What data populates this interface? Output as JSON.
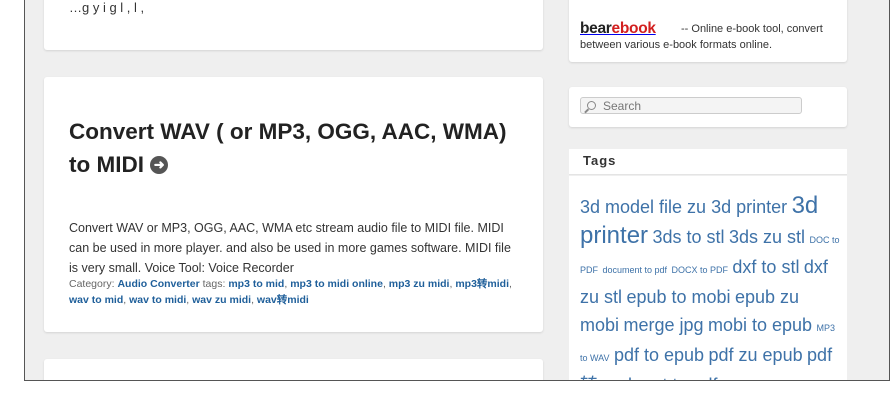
{
  "post_top": {
    "cut_text": "…g     y         i     g       l       ,    l  ,"
  },
  "post": {
    "title": "Convert WAV ( or MP3, OGG, AAC, WMA) to MIDI",
    "go_icon": "arrow-right-circle-icon",
    "text": "Convert WAV or MP3, OGG, AAC, WMA etc stream audio file to MIDI file. MIDI can be used in more player. and also be used in more games software. MIDI file is very small. Voice Tool: Voice Recorder",
    "category_label": "Category:",
    "category": "Audio Converter",
    "tags_label": "tags:",
    "tags": [
      "mp3 to mid",
      "mp3 to midi online",
      "mp3 zu midi",
      "mp3转midi",
      "wav to mid",
      "wav to midi",
      "wav zu midi",
      "wav转midi"
    ]
  },
  "sidebar": {
    "bearebook": {
      "logo_part1": "bear",
      "logo_part2": "ebook",
      "desc_line1": "-- Online e-book tool, convert",
      "desc_line2": "between various e-book formats online."
    },
    "search": {
      "placeholder": "Search",
      "icon": "search-icon"
    },
    "tags_title": "Tags",
    "tag_cloud": [
      {
        "label": "3d model file zu 3d printer",
        "size": 18
      },
      {
        "label": "3d printer",
        "size": 24
      },
      {
        "label": "3ds to stl",
        "size": 18
      },
      {
        "label": "3ds zu stl",
        "size": 18
      },
      {
        "label": "DOC to PDF",
        "size": 9
      },
      {
        "label": "document to pdf",
        "size": 9
      },
      {
        "label": "DOCX to PDF",
        "size": 9
      },
      {
        "label": "dxf to stl",
        "size": 18
      },
      {
        "label": "dxf zu stl",
        "size": 18
      },
      {
        "label": "epub to mobi",
        "size": 18
      },
      {
        "label": "epub zu mobi",
        "size": 18
      },
      {
        "label": "merge jpg",
        "size": 18
      },
      {
        "label": "mobi to epub",
        "size": 18
      },
      {
        "label": "MP3 to WAV",
        "size": 9
      },
      {
        "label": "pdf to epub",
        "size": 18
      },
      {
        "label": "pdf zu epub",
        "size": 18
      },
      {
        "label": "pdf转epub",
        "size": 18
      },
      {
        "label": "ppt to pdf",
        "size": 18
      }
    ]
  },
  "colors": {
    "link": "#1f5f9a",
    "tag": "#3e72a8",
    "logo_red": "#d21f1f",
    "background": "#efefef"
  }
}
